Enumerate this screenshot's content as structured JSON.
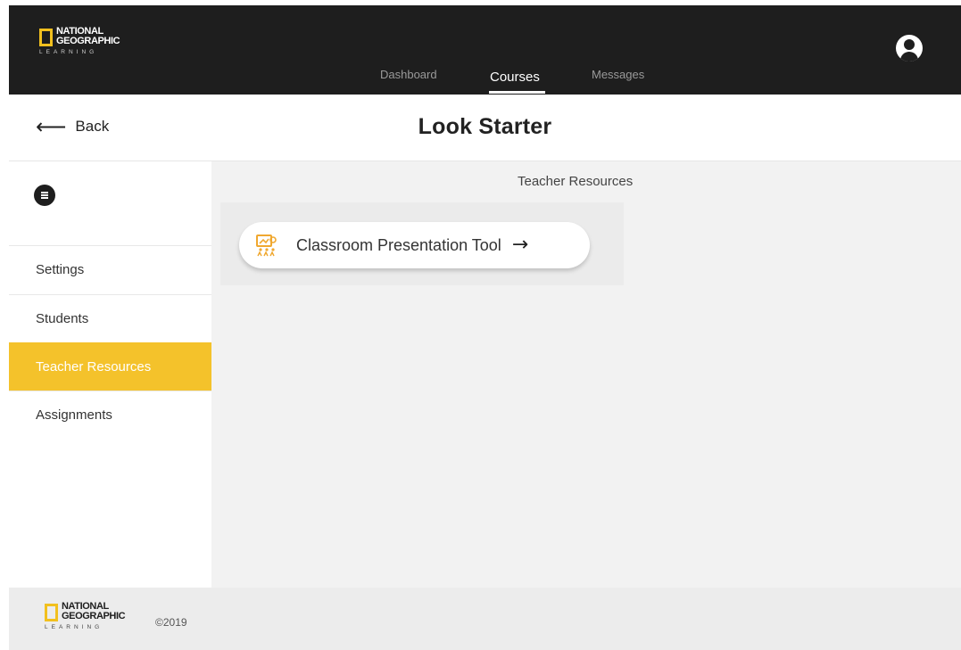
{
  "brand": {
    "name_line1": "NATIONAL",
    "name_line2": "GEOGRAPHIC",
    "name_line3": "LEARNING",
    "accent": "#f2c01e"
  },
  "nav": {
    "dashboard": "Dashboard",
    "courses": "Courses",
    "messages": "Messages",
    "active": "Courses",
    "avatar_icon": "user-avatar-icon"
  },
  "header": {
    "back_label": "Back",
    "back_icon": "arrow-left-icon",
    "title": "Look Starter"
  },
  "sidebar": {
    "menu_icon": "menu-icon",
    "items": [
      {
        "label": "Settings"
      },
      {
        "label": "Students"
      },
      {
        "label": "Teacher Resources",
        "active": true
      },
      {
        "label": "Assignments"
      }
    ],
    "active_color": "#f4c22b"
  },
  "main": {
    "section_title": "Teacher Resources",
    "resource": {
      "label": "Classroom Presentation Tool",
      "icon": "presentation-icon",
      "arrow": "→",
      "icon_color": "#f0a830"
    }
  },
  "footer": {
    "copyright": "©2019"
  }
}
